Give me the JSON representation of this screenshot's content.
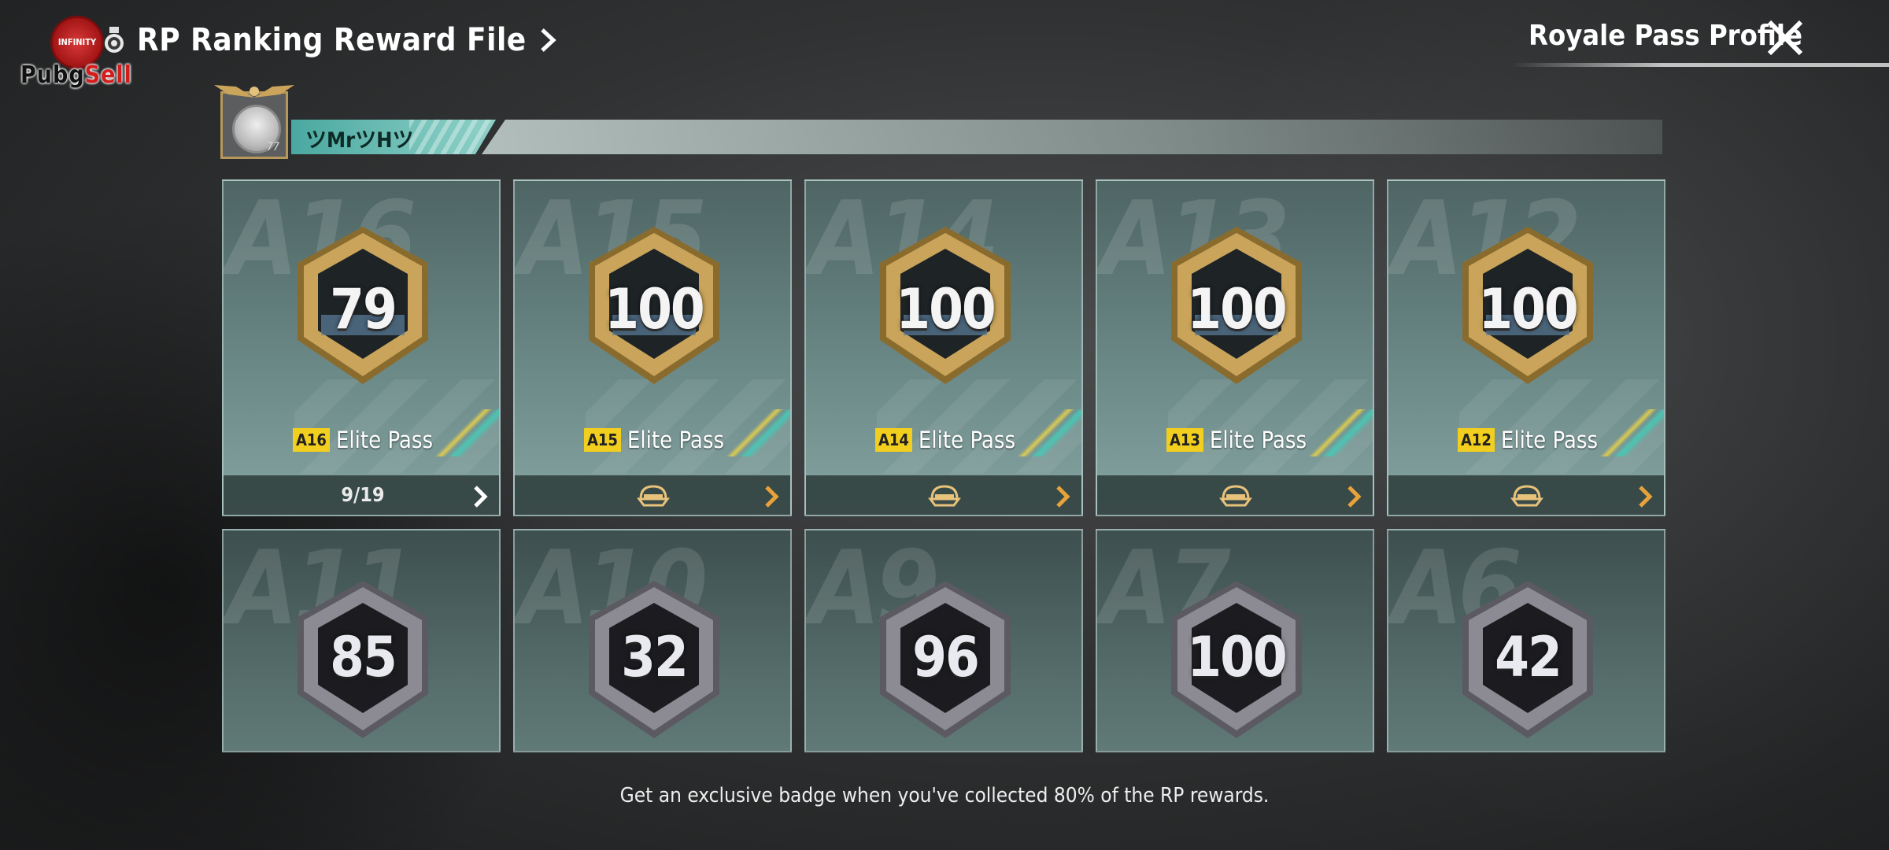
{
  "brand": {
    "badge_text": "INFINITY",
    "pubg": "Pubg",
    "sell": "Sell"
  },
  "header": {
    "title": "RP Ranking Reward File",
    "profile_label": "Royale Pass Profile"
  },
  "player": {
    "name": "ツMrツHツ",
    "level": "77"
  },
  "cards": [
    {
      "season": "A16",
      "rank": "79",
      "tag": "A16",
      "label": "Elite Pass",
      "progress": "9/19",
      "style": "gold"
    },
    {
      "season": "A15",
      "rank": "100",
      "tag": "A15",
      "label": "Elite Pass",
      "progress": "",
      "style": "gold"
    },
    {
      "season": "A14",
      "rank": "100",
      "tag": "A14",
      "label": "Elite Pass",
      "progress": "",
      "style": "gold"
    },
    {
      "season": "A13",
      "rank": "100",
      "tag": "A13",
      "label": "Elite Pass",
      "progress": "",
      "style": "gold"
    },
    {
      "season": "A12",
      "rank": "100",
      "tag": "A12",
      "label": "Elite Pass",
      "progress": "",
      "style": "gold"
    },
    {
      "season": "A11",
      "rank": "85",
      "style": "silver"
    },
    {
      "season": "A10",
      "rank": "32",
      "style": "silver"
    },
    {
      "season": "A9",
      "rank": "96",
      "style": "silver"
    },
    {
      "season": "A7",
      "rank": "100",
      "style": "silver"
    },
    {
      "season": "A6",
      "rank": "42",
      "style": "silver"
    }
  ],
  "hint": "Get an exclusive badge when you've collected 80% of the RP rewards.",
  "colors": {
    "accent_yellow": "#f2cf1e",
    "teal": "#6fbcb3",
    "gold": "#c9a45a"
  }
}
